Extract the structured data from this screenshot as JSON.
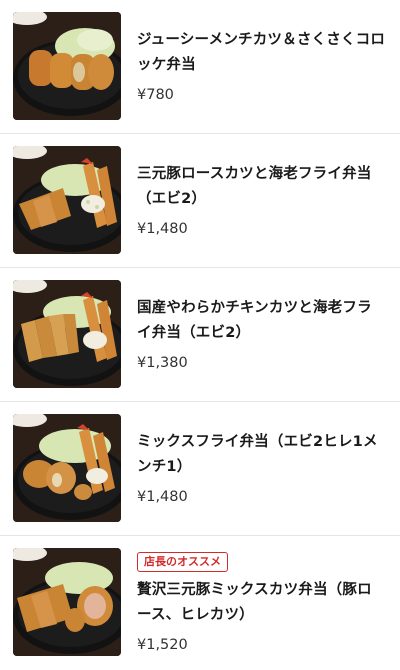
{
  "menu": {
    "items": [
      {
        "name": "ジューシーメンチカツ＆さくさくコロッケ弁当",
        "price": "¥780"
      },
      {
        "name": "三元豚ロースカツと海老フライ弁当（エビ2）",
        "price": "¥1,480"
      },
      {
        "name": "国産やわらかチキンカツと海老フライ弁当（エビ2）",
        "price": "¥1,380"
      },
      {
        "name": "ミックスフライ弁当（エビ2ヒレ1メンチ1）",
        "price": "¥1,480"
      },
      {
        "badge": "店長のオススメ",
        "name": "贅沢三元豚ミックスカツ弁当（豚ロース、ヒレカツ）",
        "price": "¥1,520"
      }
    ]
  },
  "colors": {
    "badge": "#d42a2a",
    "divider": "#e6e6e6"
  }
}
